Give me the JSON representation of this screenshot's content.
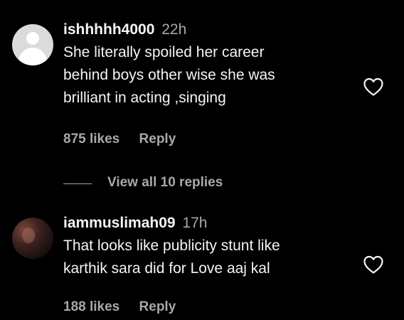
{
  "comments": [
    {
      "username": "ishhhhh4000",
      "time": "22h",
      "lines": [
        "She literally spoiled her career",
        "behind boys other wise she was",
        "brilliant in acting ,singing"
      ],
      "likes": "875 likes",
      "reply_label": "Reply",
      "avatar": "default-avatar-icon"
    },
    {
      "username": "iammuslimah09",
      "time": "17h",
      "lines": [
        "That looks like publicity stunt like",
        "karthik sara did for Love aaj kal"
      ],
      "likes": "188 likes",
      "reply_label": "Reply",
      "avatar": "user-photo"
    }
  ],
  "view_replies": "View all 10 replies",
  "colors": {
    "background": "#000000",
    "text": "#f5f5f5",
    "secondary": "#a8a8a8"
  }
}
